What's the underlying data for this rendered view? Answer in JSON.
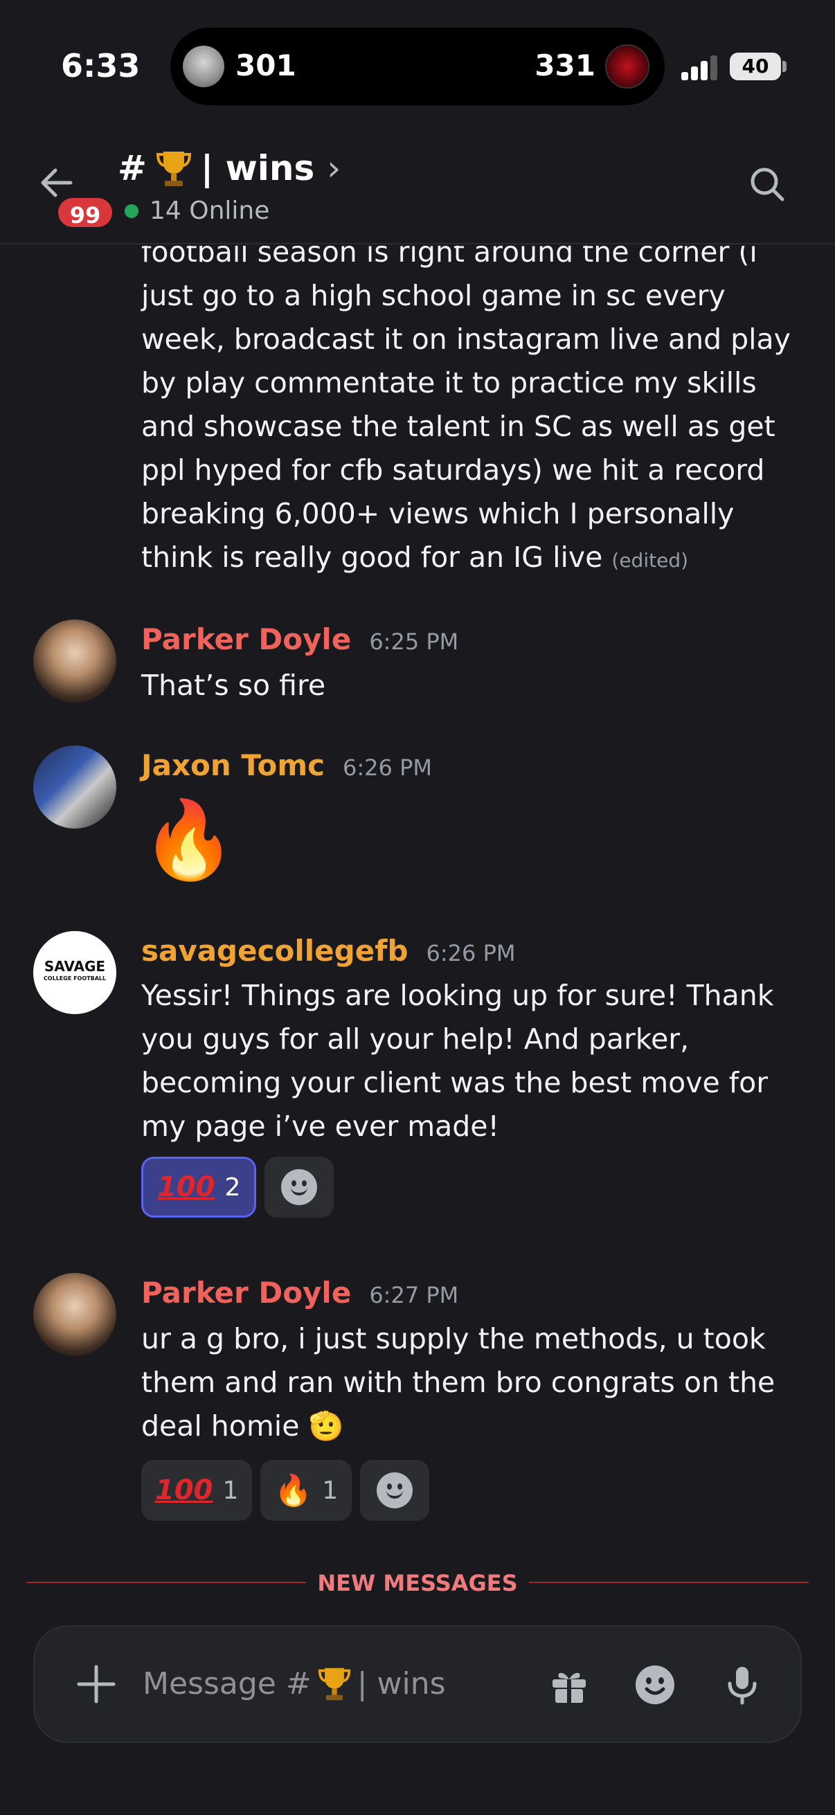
{
  "status_bar": {
    "time": "6:33",
    "live_activity": {
      "left_score": "301",
      "right_score": "331"
    },
    "battery": "40"
  },
  "header": {
    "channel_prefix": "#",
    "channel_name": "| wins",
    "chevron": "›",
    "unread_badge": "99",
    "online_text": "14 Online",
    "icons": {
      "back": "arrow-left-icon",
      "search": "search-icon",
      "channel_emoji": "trophy-icon"
    }
  },
  "messages": {
    "continuation": {
      "text": "football season is right around the corner (i just go to a high school game in sc every week, broadcast it on instagram live and play by play commentate it to practice my skills and showcase the talent in SC as well as get ppl hyped for cfb saturdays) we hit a record breaking 6,000+ views which I personally think is really good for an IG live",
      "edited_label": "(edited)"
    },
    "items": [
      {
        "author": "Parker Doyle",
        "author_color": "#f0625c",
        "timestamp": "6:25 PM",
        "text": "That’s so fire"
      },
      {
        "author": "Jaxon Tomc",
        "author_color": "#f0a232",
        "timestamp": "6:26 PM",
        "emoji": "🔥"
      },
      {
        "author": "savagecollegefb",
        "author_color": "#f0a232",
        "timestamp": "6:26 PM",
        "avatar_text": "SAVAGE",
        "avatar_subtext": "COLLEGE FOOTBALL",
        "text": "Yessir! Things are looking up for sure! Thank you guys for all your help! And parker, becoming your client was the best move for my page i’ve ever made!",
        "reactions": [
          {
            "emoji": "100",
            "count": "2",
            "active": true
          }
        ]
      },
      {
        "author": "Parker Doyle",
        "author_color": "#f0625c",
        "timestamp": "6:27 PM",
        "text": "ur a g bro, i just supply the methods, u took them and ran with them bro congrats on the deal homie",
        "trailing_emoji": "🫡",
        "reactions": [
          {
            "emoji": "100",
            "count": "1",
            "active": false
          },
          {
            "emoji": "🔥",
            "count": "1",
            "active": false
          }
        ]
      }
    ]
  },
  "divider": {
    "label": "NEW MESSAGES",
    "color": "#f07a7e"
  },
  "composer": {
    "placeholder_prefix": "Message #",
    "placeholder_suffix": "| wins",
    "icons": {
      "add": "plus-icon",
      "gift": "gift-icon",
      "emoji": "emoji-icon",
      "mic": "microphone-icon"
    }
  },
  "colors": {
    "background": "#1a1a1e",
    "online": "#23a55a",
    "badge": "#da373c",
    "accent": "#5865f2"
  }
}
